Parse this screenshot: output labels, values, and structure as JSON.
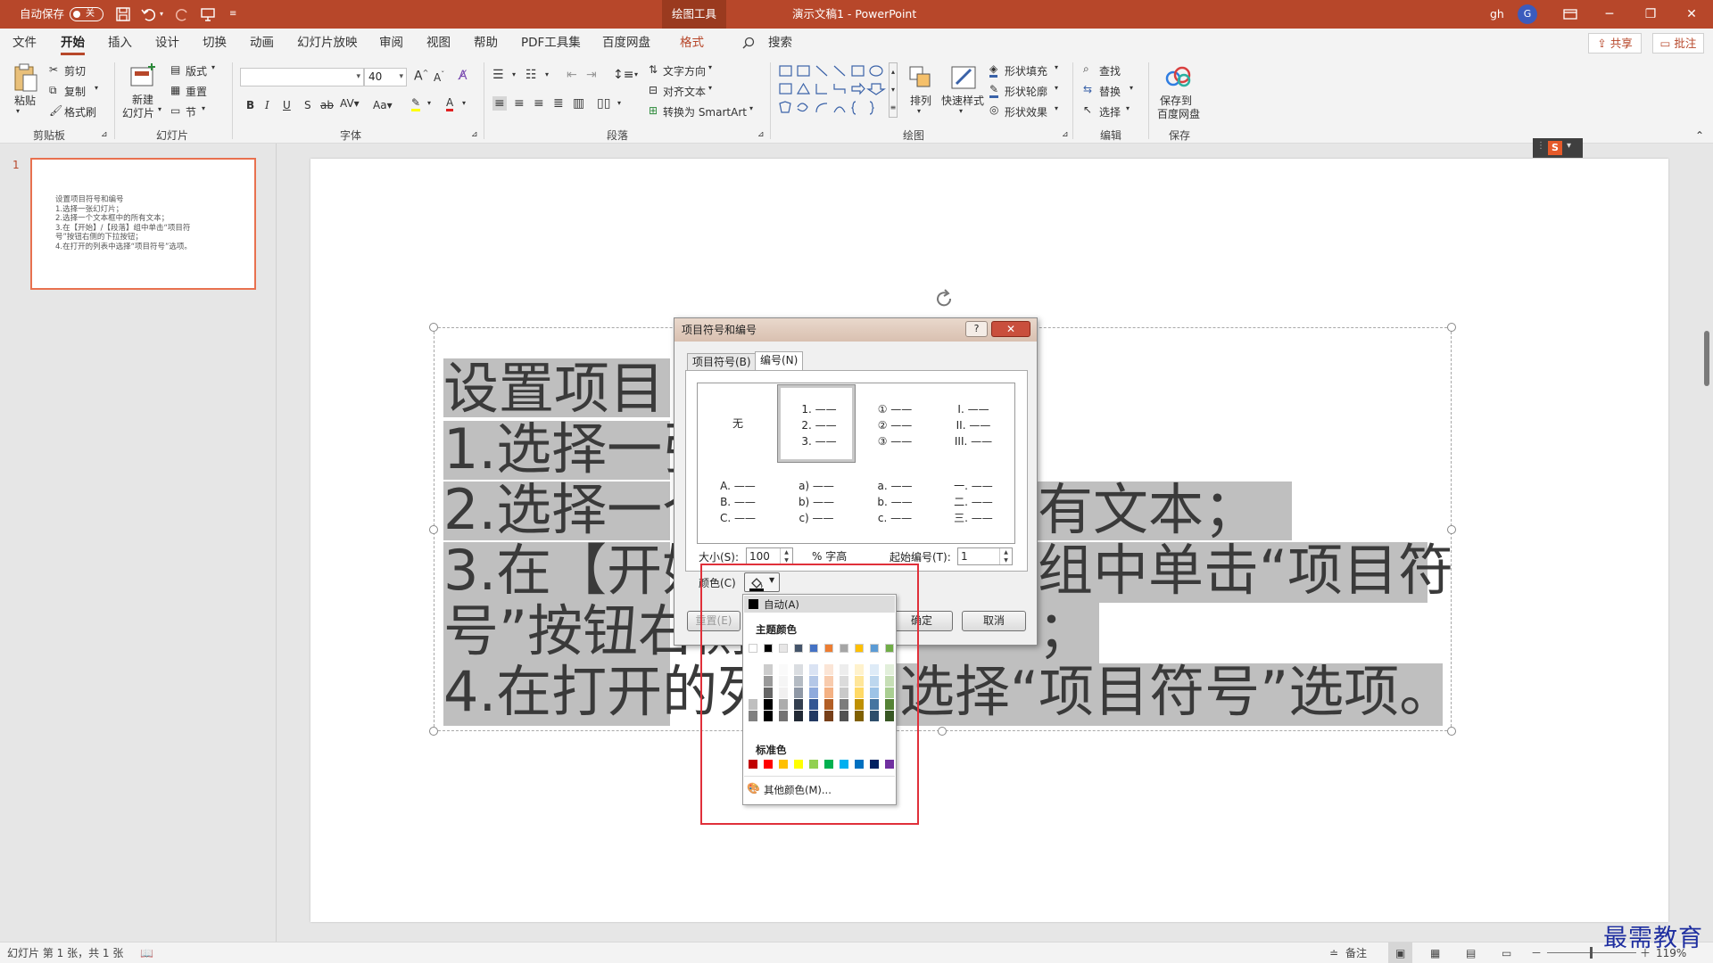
{
  "titlebar": {
    "autosave": "自动保存",
    "autosave_state": "关",
    "context_tab": "绘图工具",
    "doc_title": "演示文稿1  -  PowerPoint",
    "user": "gh",
    "avatar": "G"
  },
  "menu": {
    "items": [
      "文件",
      "开始",
      "插入",
      "设计",
      "切换",
      "动画",
      "幻灯片放映",
      "审阅",
      "视图",
      "帮助",
      "PDF工具集",
      "百度网盘",
      "格式"
    ],
    "search": "搜索",
    "share": "共享",
    "comment": "批注"
  },
  "ribbon": {
    "clipboard": {
      "paste": "粘贴",
      "cut": "剪切",
      "copy": "复制",
      "painter": "格式刷",
      "label": "剪贴板"
    },
    "slides": {
      "new1": "新建",
      "new2": "幻灯片",
      "layout": "版式",
      "reset": "重置",
      "section": "节",
      "label": "幻灯片"
    },
    "font": {
      "name": "",
      "size": "40",
      "label": "字体",
      "case": "Aa"
    },
    "paragraph": {
      "direction": "文字方向",
      "align": "对齐文本",
      "smartart": "转换为 SmartArt",
      "label": "段落"
    },
    "drawing": {
      "arrange": "排列",
      "quickstyle": "快速样式",
      "fill": "形状填充",
      "outline": "形状轮廓",
      "effect": "形状效果",
      "label": "绘图"
    },
    "editing": {
      "find": "查找",
      "replace": "替换",
      "select": "选择",
      "label": "编辑"
    },
    "save": {
      "l1": "保存到",
      "l2": "百度网盘",
      "label": "保存"
    }
  },
  "thumbnail": {
    "number": "1",
    "text": "设置项目符号和编号\n1.选择一张幻灯片；\n2.选择一个文本框中的所有文本；\n3.在【开始】/【段落】组中单击“项目符\n号”按钮右侧的下拉按钮；\n4.在打开的列表中选择“项目符号”选项。"
  },
  "slide": {
    "lines": [
      "设置项目",
      "1.选择一张",
      "2.选择一个",
      "3.在【开始",
      "号”按钮右侧",
      "4.在打开的列"
    ],
    "right_fragments": [
      "有文本；",
      "组中单击“项目符",
      "；",
      "选择“项目符号”选项。"
    ]
  },
  "dialog": {
    "title": "项目符号和编号",
    "help": "?",
    "close": "✕",
    "tab_bullets": "项目符号(B)",
    "tab_numbers": "编号(N)",
    "options": [
      {
        "lines": [
          "无"
        ]
      },
      {
        "lines": [
          "1. ——",
          "2. ——",
          "3. ——"
        ]
      },
      {
        "lines": [
          "① ——",
          "② ——",
          "③ ——"
        ]
      },
      {
        "lines": [
          "I. ——",
          "II. ——",
          "III. ——"
        ]
      },
      {
        "lines": [
          "A. ——",
          "B. ——",
          "C. ——"
        ]
      },
      {
        "lines": [
          "a) ——",
          "b) ——",
          "c) ——"
        ]
      },
      {
        "lines": [
          "a. ——",
          "b. ——",
          "c. ——"
        ]
      },
      {
        "lines": [
          "一. ——",
          "二. ——",
          "三. ——"
        ]
      }
    ],
    "size_label": "大小(S):",
    "size_value": "100",
    "size_unit": "% 字高",
    "start_label": "起始编号(T):",
    "start_value": "1",
    "color_label": "颜色(C)",
    "reset": "重置(E)",
    "ok": "确定",
    "cancel": "取消"
  },
  "palette": {
    "auto": "自动(A)",
    "theme_label": "主题颜色",
    "standard_label": "标准色",
    "more": "其他颜色(M)...",
    "theme_colors": [
      "#ffffff",
      "#000000",
      "#e7e6e6",
      "#44546a",
      "#4472c4",
      "#ed7d31",
      "#a5a5a5",
      "#ffc000",
      "#5b9bd5",
      "#70ad47"
    ],
    "standard_colors": [
      "#c00000",
      "#ff0000",
      "#ffc000",
      "#ffff00",
      "#92d050",
      "#00b050",
      "#00b0f0",
      "#0070c0",
      "#002060",
      "#7030a0"
    ]
  },
  "status": {
    "slide_info": "幻灯片 第 1 张，共 1 张",
    "notes": "备注",
    "zoom": "119%"
  },
  "watermark": "最需教育"
}
